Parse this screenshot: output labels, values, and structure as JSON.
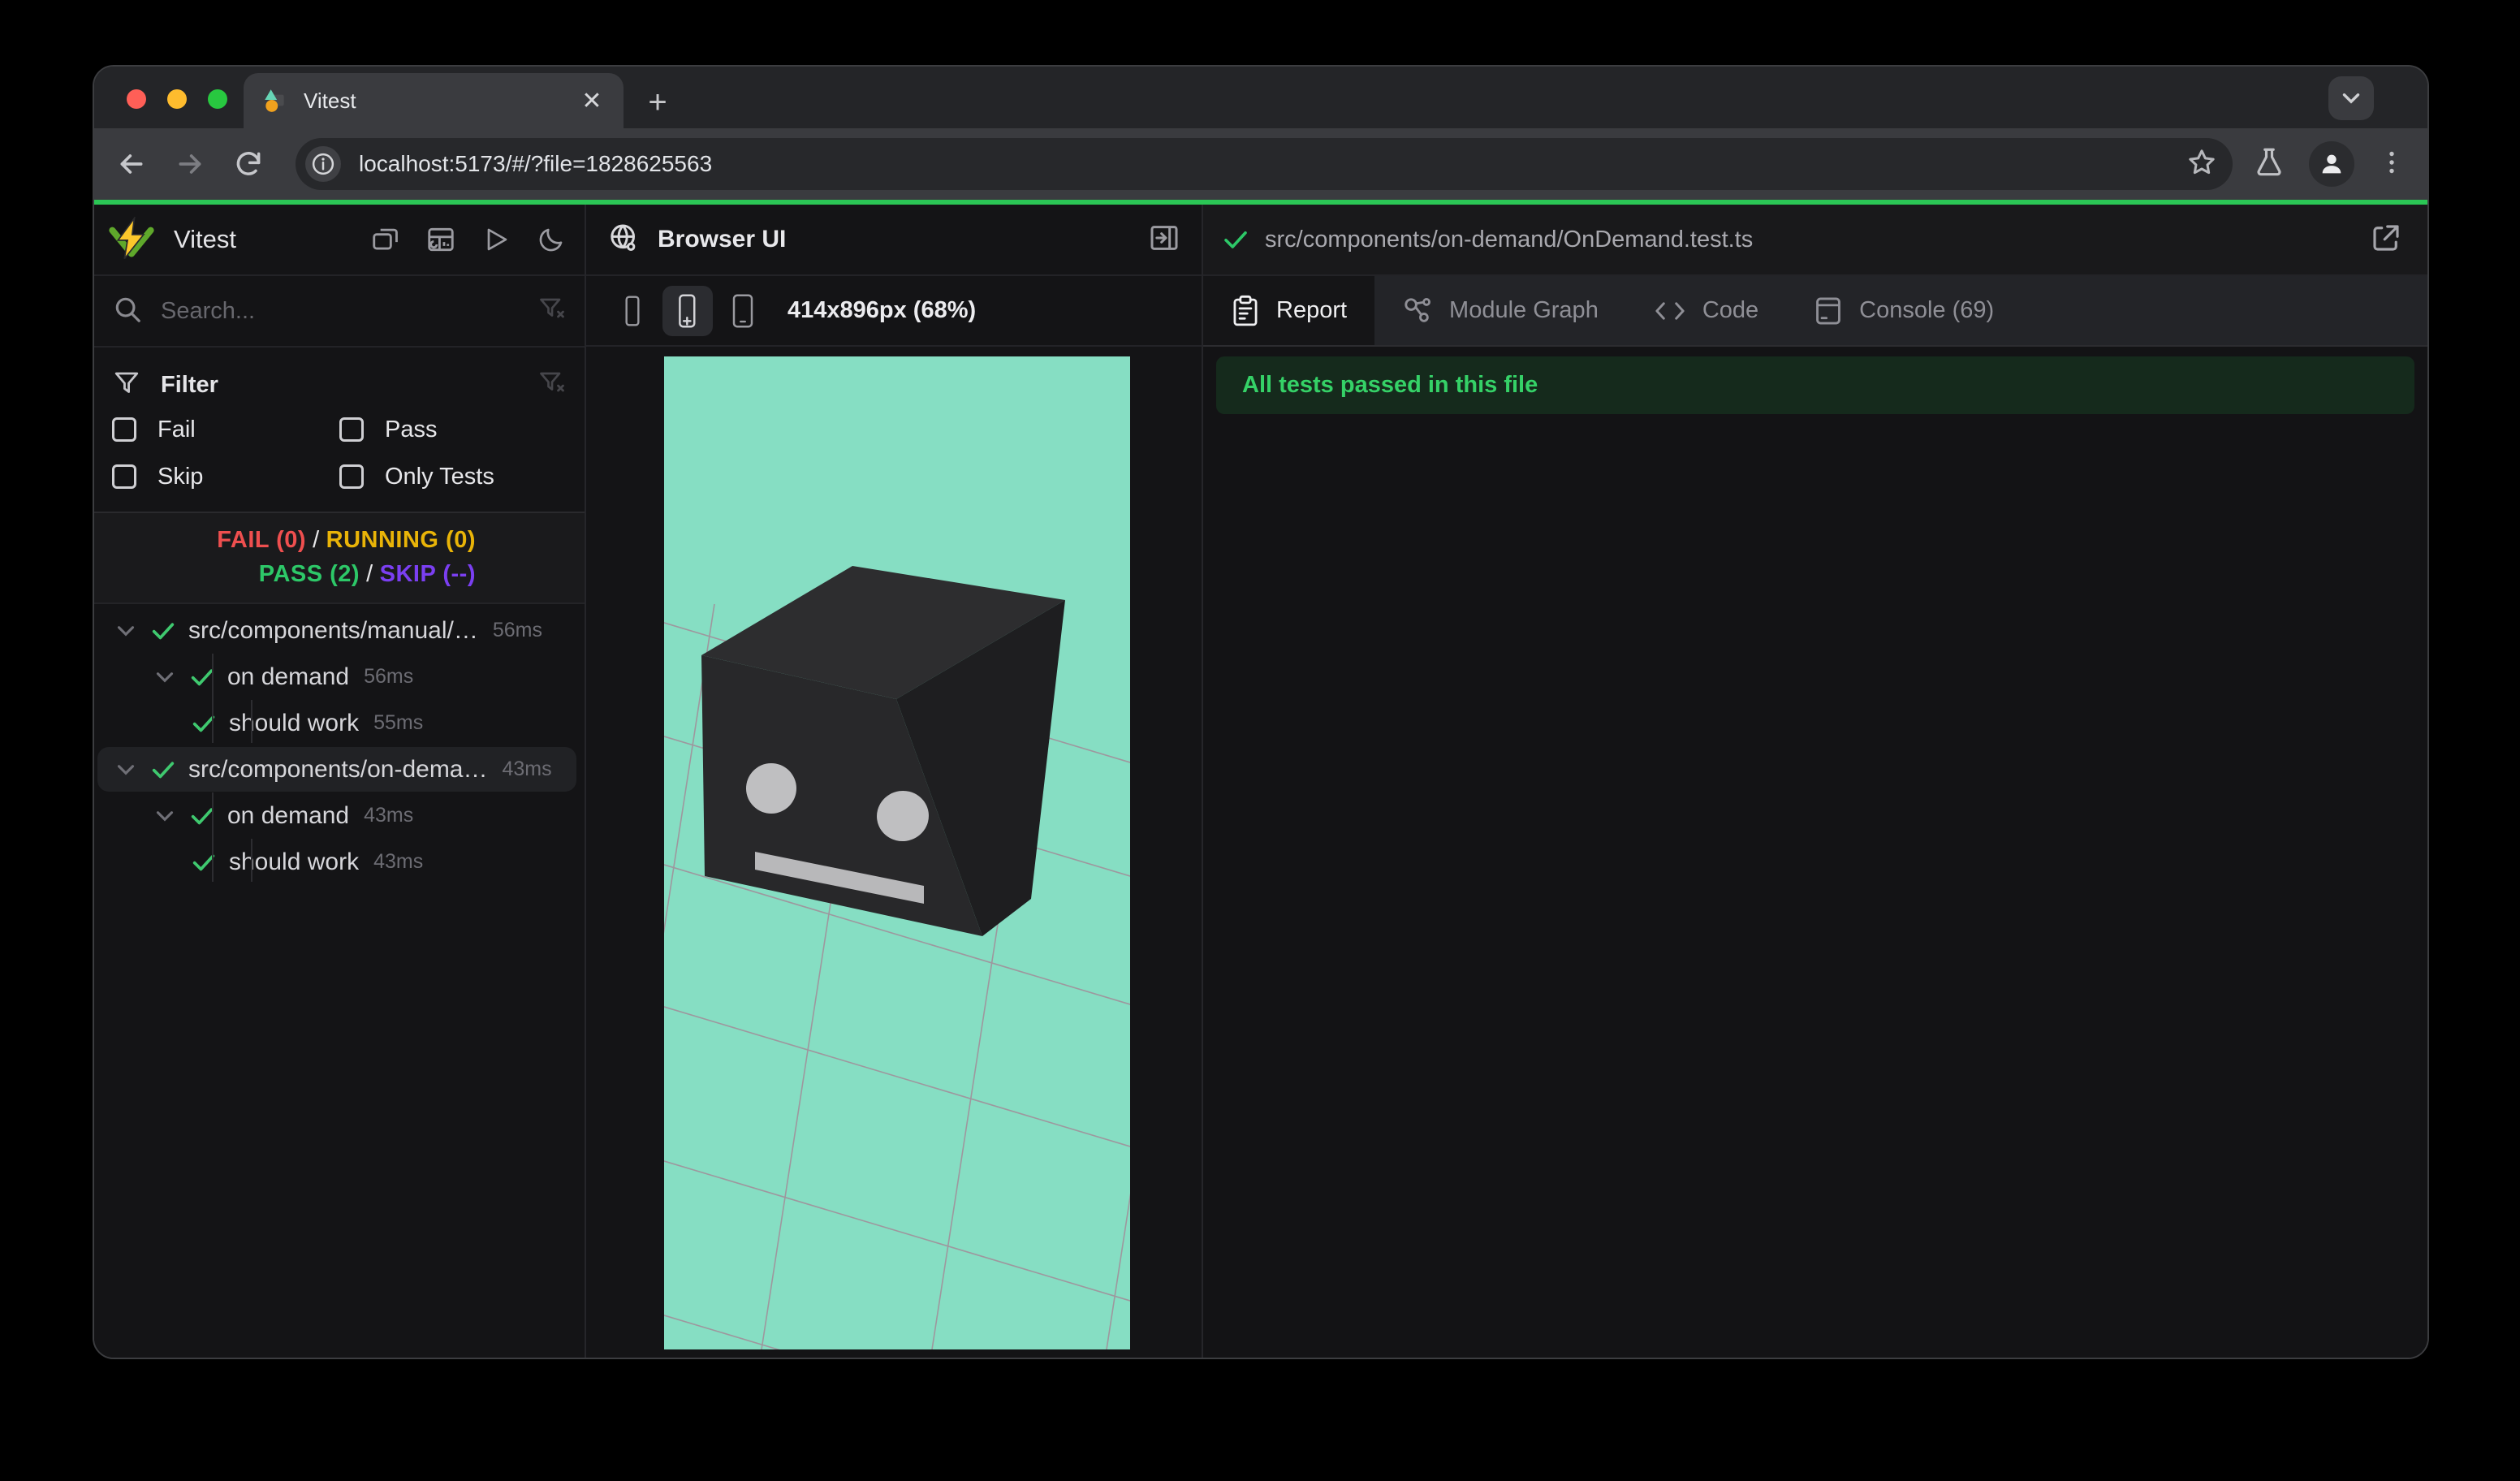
{
  "browser": {
    "tab_title": "Vitest",
    "url": "localhost:5173/#/?file=1828625563"
  },
  "sidebar": {
    "title": "Vitest",
    "search_placeholder": "Search...",
    "filter": {
      "label": "Filter",
      "options": [
        {
          "label": "Fail",
          "checked": false
        },
        {
          "label": "Pass",
          "checked": false
        },
        {
          "label": "Skip",
          "checked": false
        },
        {
          "label": "Only Tests",
          "checked": false
        }
      ]
    },
    "summary": {
      "fail": "FAIL (0)",
      "running": "RUNNING (0)",
      "pass": "PASS (2)",
      "skip": "SKIP (--)",
      "sep": "/"
    },
    "tree": [
      {
        "label": "src/components/manual/…",
        "duration": "56ms",
        "level": 1,
        "status": "pass",
        "selected": false
      },
      {
        "label": "on demand",
        "duration": "56ms",
        "level": 2,
        "status": "pass",
        "selected": false
      },
      {
        "label": "should work",
        "duration": "55ms",
        "level": 3,
        "status": "pass",
        "selected": false
      },
      {
        "label": "src/components/on-dema…",
        "duration": "43ms",
        "level": 1,
        "status": "pass",
        "selected": true
      },
      {
        "label": "on demand",
        "duration": "43ms",
        "level": 2,
        "status": "pass",
        "selected": false
      },
      {
        "label": "should work",
        "duration": "43ms",
        "level": 3,
        "status": "pass",
        "selected": false
      }
    ]
  },
  "browser_ui": {
    "title": "Browser UI",
    "viewport_label": "414x896px (68%)"
  },
  "report": {
    "file_path": "src/components/on-demand/OnDemand.test.ts",
    "tabs": [
      {
        "label": "Report",
        "active": true
      },
      {
        "label": "Module Graph",
        "active": false
      },
      {
        "label": "Code",
        "active": false
      },
      {
        "label": "Console (69)",
        "active": false
      }
    ],
    "banner": "All tests passed in this file"
  },
  "colors": {
    "accent_green": "#2bc655",
    "fail": "#ef4f4f",
    "running": "#e9b408",
    "pass": "#2dc868",
    "skip": "#7b3ff2",
    "mint_background": "#86dec3",
    "banner_bg": "#152a1c",
    "banner_text": "#35d167"
  }
}
